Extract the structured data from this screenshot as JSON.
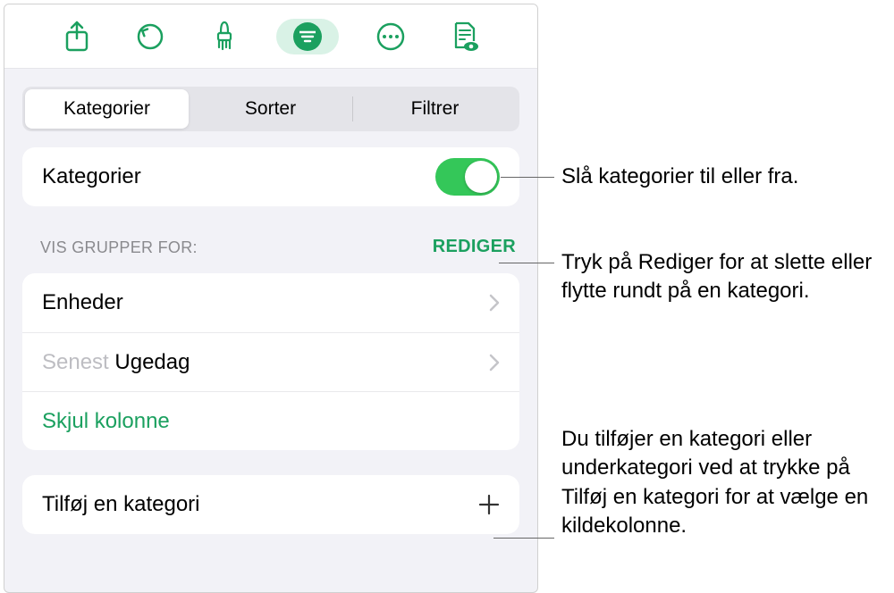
{
  "segmented": {
    "categories": "Kategorier",
    "sort": "Sorter",
    "filter": "Filtrer"
  },
  "toggle_row": {
    "label": "Kategorier"
  },
  "section": {
    "header": "VIS GRUPPER FOR:",
    "edit": "REDIGER"
  },
  "groups": {
    "row1": "Enheder",
    "row2_prefix": "Senest ",
    "row2_rest": "Ugedag",
    "hide": "Skjul kolonne"
  },
  "add_row": {
    "label": "Tilføj en kategori"
  },
  "callouts": {
    "toggle": "Slå kategorier til eller fra.",
    "edit": "Tryk på Rediger for at slette eller flytte rundt på en kategori.",
    "add": "Du tilføjer en kategori eller underkategori ved at trykke på Tilføj en kategori for at vælge en kildekolonne."
  },
  "colors": {
    "accent": "#1ba05f"
  }
}
